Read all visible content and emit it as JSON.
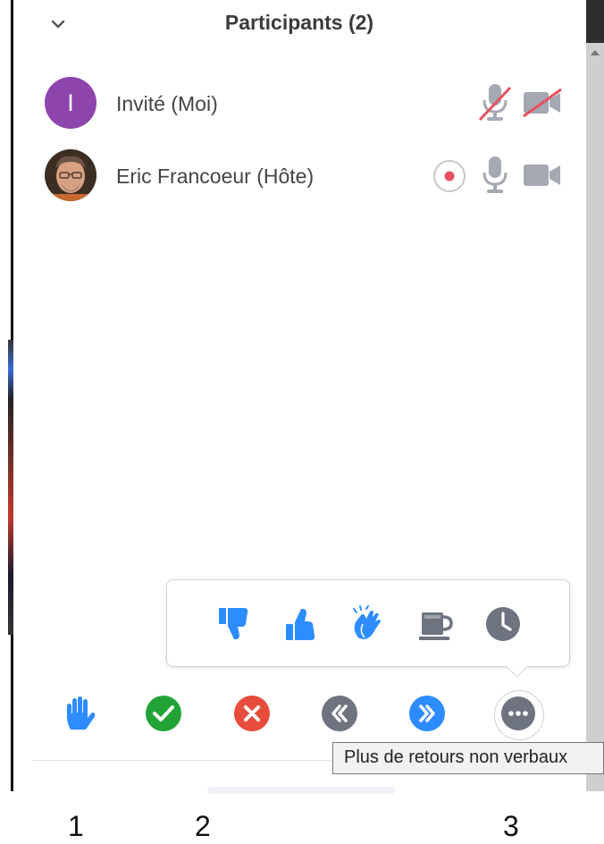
{
  "panel": {
    "title": "Participants (2)",
    "collapse_icon": "chevron-down-icon"
  },
  "participants": [
    {
      "name": "Invité (Moi)",
      "avatar_letter": "I",
      "avatar_color": "#8e44ad",
      "mic": "muted",
      "video": "off"
    },
    {
      "name": "Eric Francoeur (Hôte)",
      "avatar": "photo",
      "recording": true,
      "mic": "on",
      "video": "on"
    }
  ],
  "reactions": [
    "thumbs-down-icon",
    "thumbs-up-icon",
    "clap-icon",
    "coffee-icon",
    "clock-icon"
  ],
  "feedback_bar": [
    "raise-hand-icon",
    "yes-icon",
    "no-icon",
    "slower-icon",
    "faster-icon",
    "more-icon"
  ],
  "tooltip": "Plus de retours non verbaux",
  "annotations": [
    "1",
    "2",
    "3"
  ],
  "colors": {
    "blue": "#2d8cff",
    "green": "#21a336",
    "red": "#e74c3c",
    "gray": "#6e7380",
    "purple": "#8e44ad",
    "recording": "#e8515f"
  }
}
